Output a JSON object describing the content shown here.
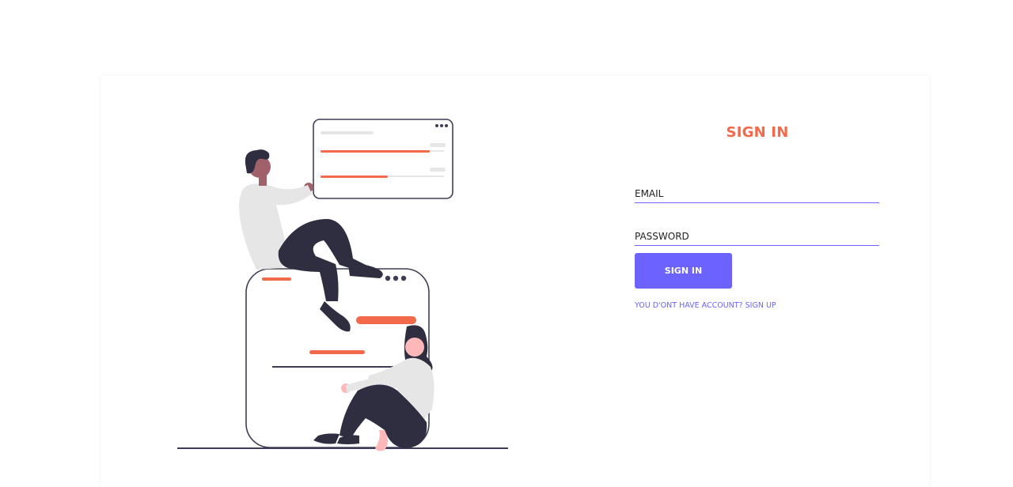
{
  "login": {
    "title": "SIGN IN",
    "email_placeholder": "EMAIL",
    "password_placeholder": "PASSWORD",
    "submit_label": "SIGN IN",
    "signup_link": "YOU D'ONT HAVE ACCOUNT? SIGN UP"
  },
  "colors": {
    "accent": "#6c63ff",
    "title": "#f2694b",
    "illustration_orange": "#f2694b",
    "illustration_dark": "#3f3d56",
    "illustration_dark_clothes": "#2f2e41",
    "illustration_shirt": "#e6e6e6",
    "skin_dark": "#a0616a",
    "skin_light": "#ffb8b8"
  },
  "illustration": {
    "name": "people-with-ui-cards"
  }
}
